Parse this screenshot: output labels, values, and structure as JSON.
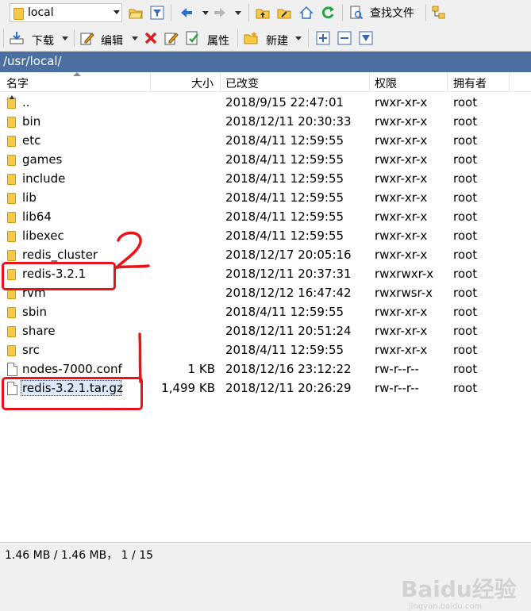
{
  "toolbar_top": {
    "location_value": "local",
    "find_files_label": "查找文件"
  },
  "toolbar_bottom": {
    "download_label": "下载",
    "edit_label": "编辑",
    "properties_label": "属性",
    "new_label": "新建"
  },
  "path": "/usr/local/",
  "columns": {
    "name": "名字",
    "size": "大小",
    "modified": "已改变",
    "permissions": "权限",
    "owner": "拥有者"
  },
  "files": [
    {
      "name": "..",
      "size": "",
      "modified": "2018/9/15 22:47:01",
      "permissions": "rwxr-xr-x",
      "owner": "root",
      "type": "updir"
    },
    {
      "name": "bin",
      "size": "",
      "modified": "2018/12/11 20:30:33",
      "permissions": "rwxr-xr-x",
      "owner": "root",
      "type": "folder"
    },
    {
      "name": "etc",
      "size": "",
      "modified": "2018/4/11 12:59:55",
      "permissions": "rwxr-xr-x",
      "owner": "root",
      "type": "folder"
    },
    {
      "name": "games",
      "size": "",
      "modified": "2018/4/11 12:59:55",
      "permissions": "rwxr-xr-x",
      "owner": "root",
      "type": "folder"
    },
    {
      "name": "include",
      "size": "",
      "modified": "2018/4/11 12:59:55",
      "permissions": "rwxr-xr-x",
      "owner": "root",
      "type": "folder"
    },
    {
      "name": "lib",
      "size": "",
      "modified": "2018/4/11 12:59:55",
      "permissions": "rwxr-xr-x",
      "owner": "root",
      "type": "folder"
    },
    {
      "name": "lib64",
      "size": "",
      "modified": "2018/4/11 12:59:55",
      "permissions": "rwxr-xr-x",
      "owner": "root",
      "type": "folder"
    },
    {
      "name": "libexec",
      "size": "",
      "modified": "2018/4/11 12:59:55",
      "permissions": "rwxr-xr-x",
      "owner": "root",
      "type": "folder"
    },
    {
      "name": "redis_cluster",
      "size": "",
      "modified": "2018/12/17 20:05:16",
      "permissions": "rwxr-xr-x",
      "owner": "root",
      "type": "folder"
    },
    {
      "name": "redis-3.2.1",
      "size": "",
      "modified": "2018/12/11 20:37:31",
      "permissions": "rwxrwxr-x",
      "owner": "root",
      "type": "folder"
    },
    {
      "name": "rvm",
      "size": "",
      "modified": "2018/12/12 16:47:42",
      "permissions": "rwxrwsr-x",
      "owner": "root",
      "type": "folder"
    },
    {
      "name": "sbin",
      "size": "",
      "modified": "2018/4/11 12:59:55",
      "permissions": "rwxr-xr-x",
      "owner": "root",
      "type": "folder"
    },
    {
      "name": "share",
      "size": "",
      "modified": "2018/12/11 20:51:24",
      "permissions": "rwxr-xr-x",
      "owner": "root",
      "type": "folder"
    },
    {
      "name": "src",
      "size": "",
      "modified": "2018/4/11 12:59:55",
      "permissions": "rwxr-xr-x",
      "owner": "root",
      "type": "folder"
    },
    {
      "name": "nodes-7000.conf",
      "size": "1 KB",
      "modified": "2018/12/16 23:12:22",
      "permissions": "rw-r--r--",
      "owner": "root",
      "type": "file"
    },
    {
      "name": "redis-3.2.1.tar.gz",
      "size": "1,499 KB",
      "modified": "2018/12/11 20:26:29",
      "permissions": "rw-r--r--",
      "owner": "root",
      "type": "file",
      "selected": true
    }
  ],
  "annotations": [
    "2",
    "1"
  ],
  "status": "1.46 MB / 1.46 MB， 1 / 15",
  "watermark": "Baidu经验",
  "watermark_sub": "jingyan.baidu.com",
  "colors": {
    "path_bar": "#4a6fa0",
    "annotation_red": "#e8141a",
    "folder": "#f7c948"
  }
}
